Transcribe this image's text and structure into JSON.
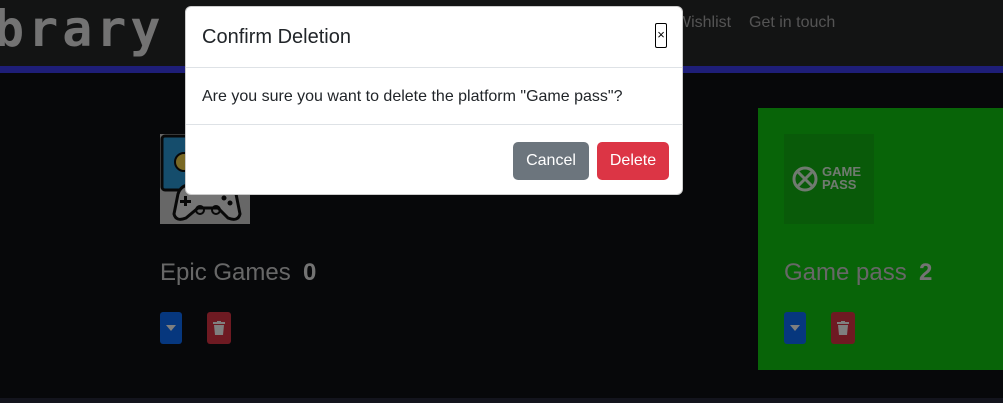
{
  "navbar": {
    "brand": "brary",
    "links": [
      "Wishlist",
      "Get in touch"
    ]
  },
  "platforms": [
    {
      "name": "Epic Games",
      "count": "0"
    },
    {
      "name": "Game pass",
      "count": "2",
      "logo_text_1": "GAME",
      "logo_text_2": "PASS"
    }
  ],
  "modal": {
    "title": "Confirm Deletion",
    "close_label": "×",
    "message": "Are you sure you want to delete the platform \"Game pass\"?",
    "cancel_label": "Cancel",
    "delete_label": "Delete"
  },
  "colors": {
    "accent_blue": "#0d6efd",
    "danger": "#dc3545",
    "secondary": "#6c757d",
    "gamepass_green": "#11c911"
  },
  "icons": [
    "controller-icon",
    "xbox-logo-icon",
    "caret-down-icon",
    "trash-icon"
  ]
}
